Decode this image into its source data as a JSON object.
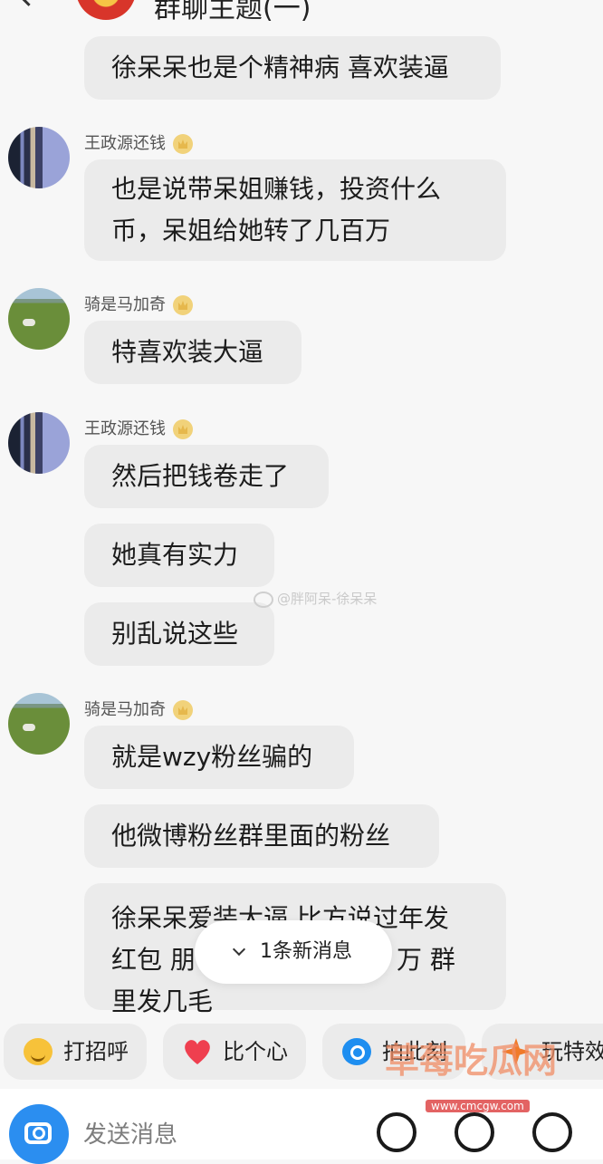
{
  "header": {
    "title": "群聊主题(一)"
  },
  "messages": [
    {
      "type": "bubble",
      "text": "徐呆呆也是个精神病 喜欢装逼"
    },
    {
      "type": "sender",
      "name": "王政源还钱"
    },
    {
      "type": "bubble",
      "lines": [
        "也是说带呆姐赚钱，投资什么",
        "币，呆姐给她转了几百万"
      ]
    },
    {
      "type": "sender",
      "name": "骑是马加奇"
    },
    {
      "type": "bubble",
      "text": "特喜欢装大逼"
    },
    {
      "type": "sender",
      "name": "王政源还钱"
    },
    {
      "type": "bubble",
      "text": "然后把钱卷走了"
    },
    {
      "type": "bubble",
      "text": "她真有实力"
    },
    {
      "type": "bubble",
      "text": "别乱说这些"
    },
    {
      "type": "sender",
      "name": "骑是马加奇"
    },
    {
      "type": "bubble",
      "text": "就是wzy粉丝骗的"
    },
    {
      "type": "bubble",
      "text": "他微博粉丝群里面的粉丝"
    },
    {
      "type": "bubble",
      "lines": [
        "徐呆呆爱装大逼 比方说过年发",
        "红包 朋",
        "里发几毛"
      ],
      "partial_tail": "万 群"
    }
  ],
  "watermark": "@胖阿呆-徐呆呆",
  "new_messages": {
    "label": "1条新消息",
    "icon": "chevron-down-icon"
  },
  "quick_actions": [
    {
      "label": "打招呼",
      "icon": "smile-icon"
    },
    {
      "label": "比个心",
      "icon": "heart-icon"
    },
    {
      "label": "拍此刻",
      "icon": "camera-icon"
    },
    {
      "label": "玩特效",
      "icon": "sparkle-icon"
    }
  ],
  "composer": {
    "placeholder": "发送消息",
    "icons": [
      "camera-icon",
      "voice-icon",
      "emoji-icon",
      "add-icon"
    ]
  },
  "site_watermark": {
    "name": "草莓吃瓜网",
    "url": "www.cmcgw.com"
  },
  "colors": {
    "accent": "#2b8ef0",
    "bubble": "#ebebeb",
    "background": "#f7f7f7"
  }
}
